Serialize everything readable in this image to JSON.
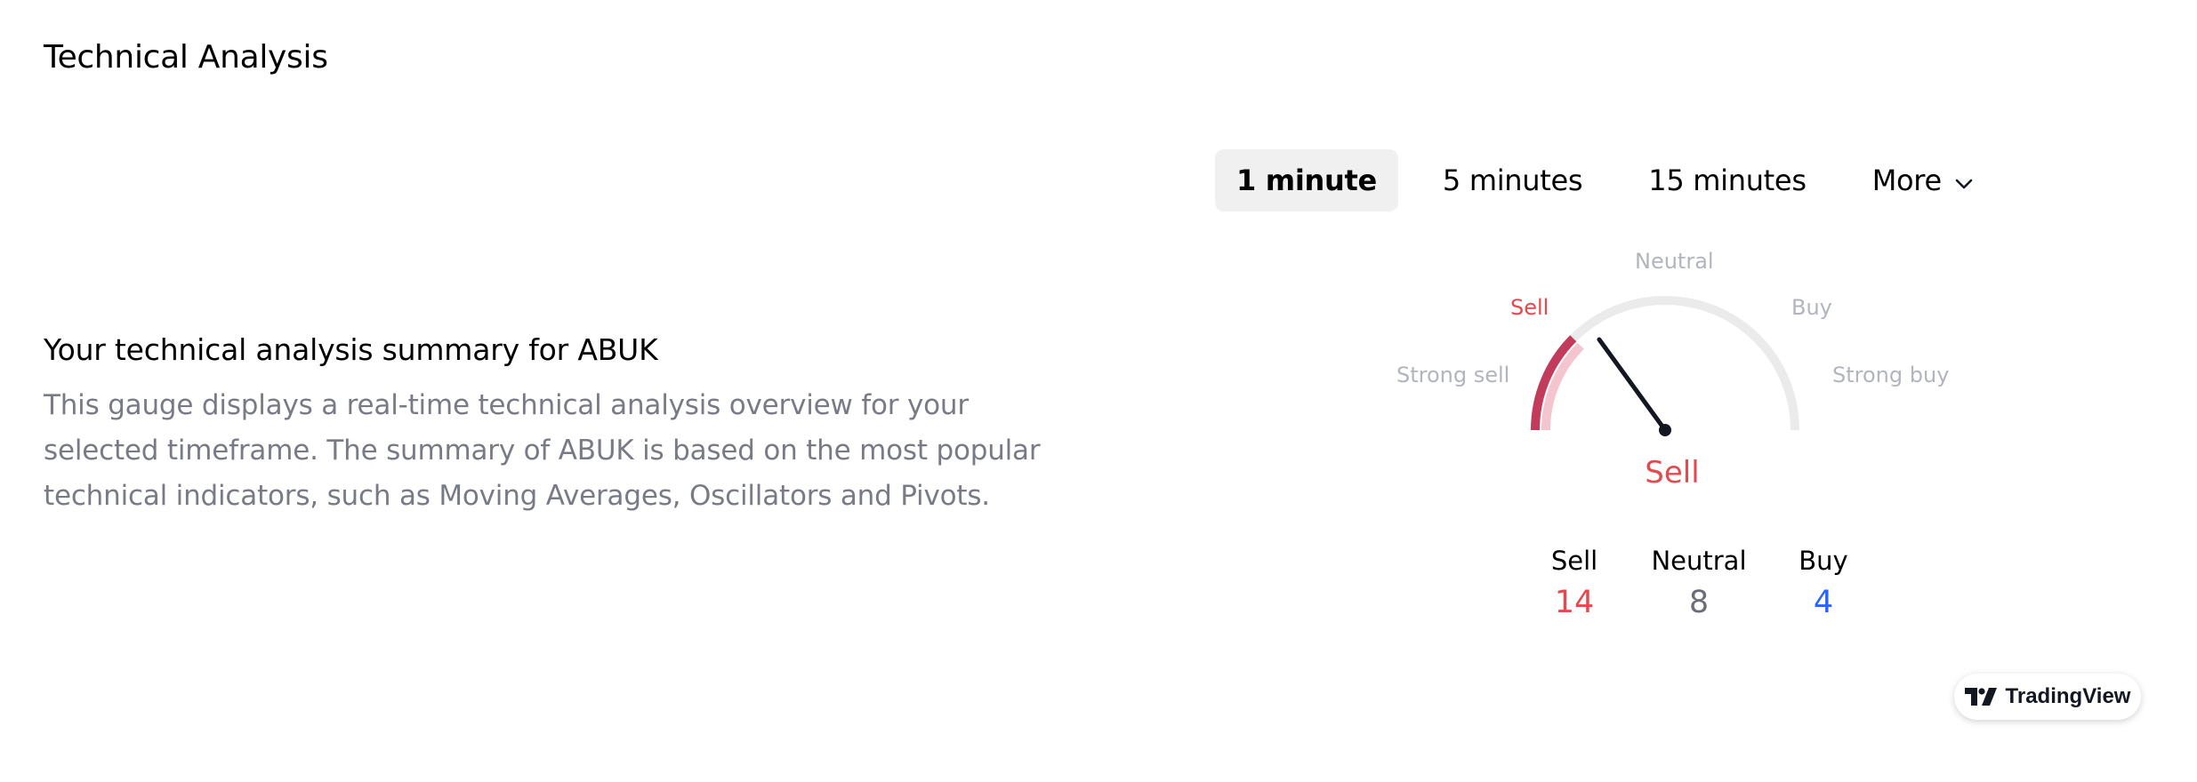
{
  "page": {
    "title": "Technical Analysis"
  },
  "summary": {
    "title": "Your technical analysis summary for ABUK",
    "description": "This gauge displays a real-time technical analysis overview for your selected timeframe. The summary of ABUK is based on the most popular technical indicators, such as Moving Averages, Oscillators and Pivots."
  },
  "timeframes": {
    "tabs": [
      {
        "label": "1 minute",
        "active": true
      },
      {
        "label": "5 minutes",
        "active": false
      },
      {
        "label": "15 minutes",
        "active": false
      },
      {
        "label": "More",
        "active": false,
        "icon": "chevron-down-icon"
      }
    ]
  },
  "gauge": {
    "labels": {
      "strong_sell": "Strong sell",
      "sell": "Sell",
      "neutral": "Neutral",
      "buy": "Buy",
      "strong_buy": "Strong buy"
    },
    "result": "Sell",
    "needle_fraction": 0.3,
    "colors": {
      "sell": "#e5484d",
      "neutral": "#787b86",
      "buy": "#2962ff",
      "track": "#ebebeb"
    }
  },
  "counters": [
    {
      "label": "Sell",
      "value": "14",
      "color": "#e5484d"
    },
    {
      "label": "Neutral",
      "value": "8",
      "color": "#6a6d78"
    },
    {
      "label": "Buy",
      "value": "4",
      "color": "#2962ff"
    }
  ],
  "branding": {
    "label": "TradingView",
    "icon": "tradingview-logo-icon"
  }
}
